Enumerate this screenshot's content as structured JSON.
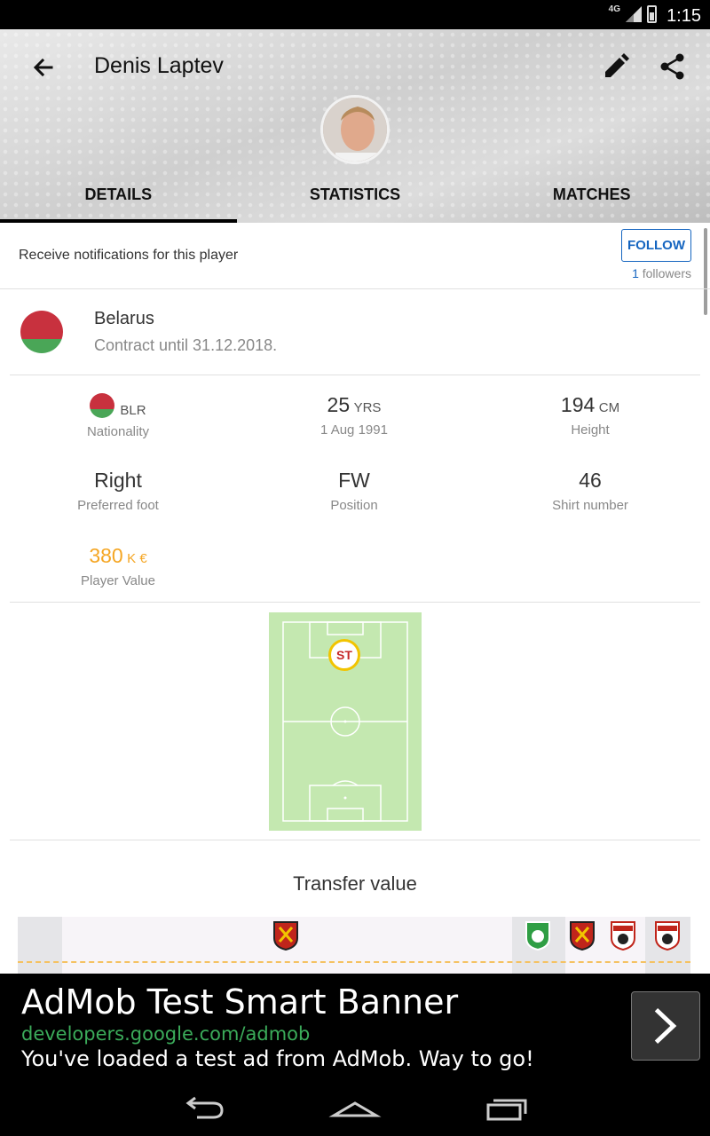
{
  "status_bar": {
    "network": "4G",
    "time": "1:15"
  },
  "header": {
    "title": "Denis Laptev",
    "tabs": [
      {
        "label": "DETAILS",
        "active": true
      },
      {
        "label": "STATISTICS",
        "active": false
      },
      {
        "label": "MATCHES",
        "active": false
      }
    ]
  },
  "notifications": {
    "text": "Receive notifications for this player",
    "follow_label": "FOLLOW",
    "followers_count": "1",
    "followers_label": "followers"
  },
  "country": {
    "name": "Belarus",
    "contract": "Contract until 31.12.2018."
  },
  "stats": {
    "nationality": {
      "value": "BLR",
      "label": "Nationality"
    },
    "age": {
      "value": "25",
      "unit": "YRS",
      "sub": "1 Aug 1991"
    },
    "height": {
      "value": "194",
      "unit": "CM",
      "label": "Height"
    },
    "foot": {
      "value": "Right",
      "label": "Preferred foot"
    },
    "position": {
      "value": "FW",
      "label": "Position"
    },
    "shirt": {
      "value": "46",
      "label": "Shirt number"
    },
    "player_value": {
      "value": "380",
      "unit": "K €",
      "label": "Player Value"
    }
  },
  "pitch": {
    "position_badge": "ST"
  },
  "transfer": {
    "title": "Transfer value"
  },
  "ad": {
    "title": "AdMob Test Smart Banner",
    "url": "developers.google.com/admob",
    "description": "You've loaded a test ad from AdMob. Way to go!"
  },
  "colors": {
    "accent_blue": "#1565c0",
    "value_orange": "#f5a623",
    "pitch_green": "#c4e8b0",
    "flag_red": "#c8313e",
    "flag_green": "#4aa657"
  }
}
